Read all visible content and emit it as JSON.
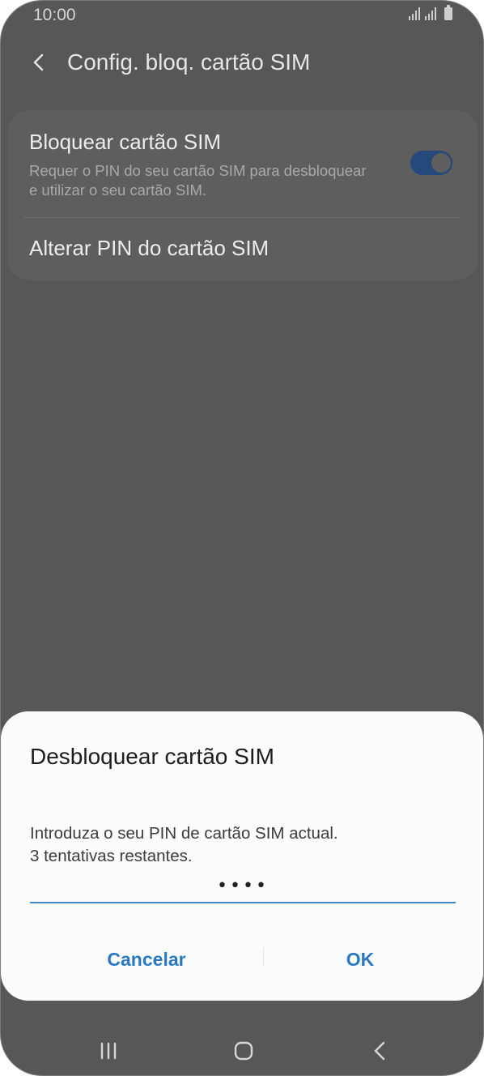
{
  "status_bar": {
    "time": "10:00",
    "icons": [
      "signal-icon",
      "signal-icon",
      "battery-icon"
    ]
  },
  "header": {
    "title": "Config. bloq. cartão SIM",
    "back_icon": "chevron-left-icon"
  },
  "settings": {
    "lock_sim": {
      "title": "Bloquear cartão SIM",
      "description": "Requer o PIN do seu cartão SIM para desbloquear e utilizar o seu cartão SIM.",
      "enabled": true
    },
    "change_pin": {
      "title": "Alterar PIN do cartão SIM"
    }
  },
  "dialog": {
    "title": "Desbloquear cartão SIM",
    "message_line1": "Introduza o seu PIN de cartão SIM actual.",
    "message_line2": "3 tentativas restantes.",
    "pin_value": "••••",
    "cancel_label": "Cancelar",
    "ok_label": "OK"
  },
  "colors": {
    "accent": "#2a78c3",
    "input_underline": "#3f86cf",
    "toggle_on": "#25497a",
    "overlay_background": "#575757"
  },
  "nav_bar": {
    "icons": [
      "recent-apps-icon",
      "home-icon",
      "back-icon"
    ]
  }
}
